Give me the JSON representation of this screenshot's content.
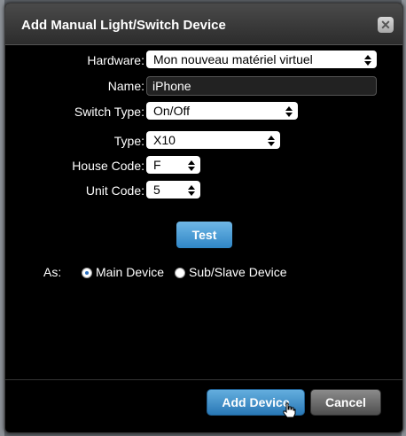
{
  "dialog": {
    "title": "Add Manual Light/Switch Device",
    "close_icon": "close-icon"
  },
  "form": {
    "hardware_label": "Hardware:",
    "hardware_value": "Mon nouveau matériel virtuel",
    "name_label": "Name:",
    "name_value": "iPhone",
    "switch_type_label": "Switch Type:",
    "switch_type_value": "On/Off",
    "type_label": "Type:",
    "type_value": "X10",
    "house_code_label": "House Code:",
    "house_code_value": "F",
    "unit_code_label": "Unit Code:",
    "unit_code_value": "5"
  },
  "test_button_label": "Test",
  "as": {
    "label": "As:",
    "main_device_label": "Main Device",
    "sub_slave_label": "Sub/Slave Device",
    "selected": "main"
  },
  "footer": {
    "add_device_label": "Add Device",
    "cancel_label": "Cancel"
  },
  "colors": {
    "accent": "#2f86c6",
    "background": "#000000"
  }
}
